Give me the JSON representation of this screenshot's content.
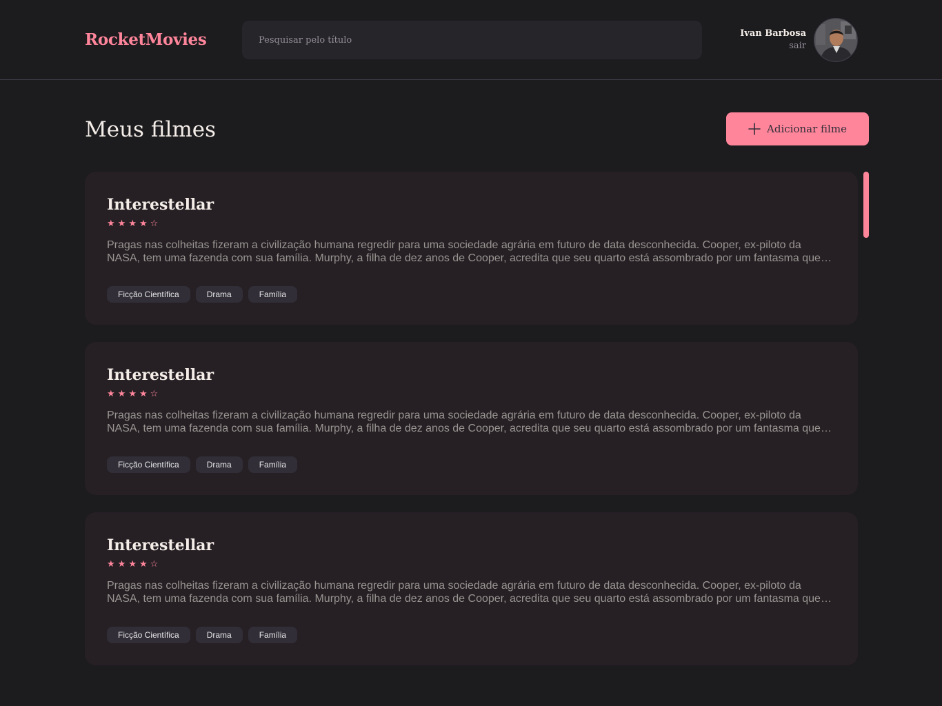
{
  "header": {
    "brand": "RocketMovies",
    "search_placeholder": "Pesquisar pelo título",
    "search_value": "",
    "user_name": "Ivan Barbosa",
    "logout_label": "sair"
  },
  "main": {
    "title": "Meus filmes",
    "add_button_label": "Adicionar filme",
    "add_icon": "plus-icon",
    "movies": [
      {
        "title": "Interestellar",
        "rating": 4,
        "rating_max": 5,
        "description": "Pragas nas colheitas fizeram a civilização humana regredir para uma sociedade agrária em futuro de data desconhecida. Cooper, ex-piloto da NASA, tem uma fazenda com sua família. Murphy, a filha de dez anos de Cooper, acredita que seu quarto está assombrado por um fantasma que tenta se…",
        "tags": [
          "Ficção Científica",
          "Drama",
          "Família"
        ]
      },
      {
        "title": "Interestellar",
        "rating": 4,
        "rating_max": 5,
        "description": "Pragas nas colheitas fizeram a civilização humana regredir para uma sociedade agrária em futuro de data desconhecida. Cooper, ex-piloto da NASA, tem uma fazenda com sua família. Murphy, a filha de dez anos de Cooper, acredita que seu quarto está assombrado por um fantasma que tenta se…",
        "tags": [
          "Ficção Científica",
          "Drama",
          "Família"
        ]
      },
      {
        "title": "Interestellar",
        "rating": 4,
        "rating_max": 5,
        "description": "Pragas nas colheitas fizeram a civilização humana regredir para uma sociedade agrária em futuro de data desconhecida. Cooper, ex-piloto da NASA, tem uma fazenda com sua família. Murphy, a filha de dez anos de Cooper, acredita que seu quarto está assombrado por um fantasma que tenta se…",
        "tags": [
          "Ficção Científica",
          "Drama",
          "Família"
        ]
      }
    ]
  },
  "colors": {
    "background": "#1c1b1e",
    "accent": "#ff859b",
    "card": "#262025",
    "input": "#262529",
    "tag": "#312e38",
    "text": "#f4ede8",
    "muted": "#999591"
  }
}
